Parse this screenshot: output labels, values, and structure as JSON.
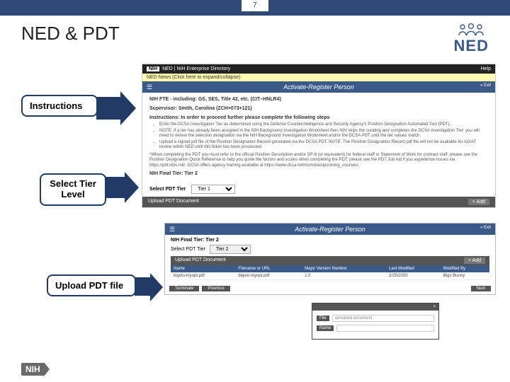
{
  "page_number": "7",
  "title": "NED & PDT",
  "logo_text": "NED",
  "callouts": {
    "c1": "Instructions",
    "c2": "Select Tier\nLevel",
    "c3": "Upload PDT file"
  },
  "ned_top": {
    "nih_tag": "NIH",
    "header": "NED | NIH Enterprise Directory",
    "help": "Help",
    "news": "NED News (Click here to expand/collapse)",
    "banner": "Activate-Register Person",
    "banner_end": "« Exit",
    "fte_line": "NIH FTE - including: GS, SES, Title 42, etc. (CIT–HNLR4)",
    "supervisor_line": "Supervisor: Smith, Carolina (ZCH+073+121)",
    "instr_header": "Instructions: In order to proceed further please complete the following steps",
    "bullets": [
      "Enter the DCSA Investigation Tier as determined using the Defense Counterintelligence and Security Agency's Position Designation Automated Tool (PDT).",
      "NOTE: If a tier has already been assigned in the NIH Background Investigation Worksheet then NIH skips the curating and completes the DCSA Investigation Tier; you will need to review the selection designation via the NIH Background Investigation Worksheet and/or the DCSA PDT until the tier values match.",
      "Upload a signed pdf file of the Position Designation Record generated via the DCSA PDT. NOTE: The Position Designation Record pdf file will not be available for AO/AT review within NED until this ticket has been processed."
    ],
    "footnote": "*When completing the PDT you must refer to the official Position Description and/or OF-8 (or equivalent) for federal staff or Statement of Work for contract staff; please see the Position Designation Quick Reference to help you guide the factors and scores when completing the PDT; please see the PDT Job Aid if you experience issues via https://pdt.nbis.mil/. DCSA offers agency training available at https://www.dcsa.mil/mc/ndse/upcoming_courses/.",
    "final_tier_label": "NIH Final Tier:",
    "final_tier_value": "Tier 2",
    "select_label": "Select PDT Tier",
    "tier_options": [
      "Tier 1"
    ],
    "upload_bar": "Upload PDT Document",
    "add": "+ Add"
  },
  "ned_second": {
    "banner": "Activate-Register Person",
    "banner_end": "« Exit",
    "tier_line_label": "NIH Final Tier:",
    "tier_line_value": "Tier 2",
    "select_label": "Select PDT Tier",
    "tier_options": [
      "Tier 2"
    ],
    "upload_label": "Upload PDT Document",
    "add": "+ Add",
    "table": {
      "headers": [
        "Name",
        "Filename or URL",
        "Major Version Number",
        "Last Modified",
        "Modified By"
      ],
      "row": [
        "bigvio-myopt.pdf",
        "bigvio-myopt.pdf",
        "1.0",
        "2/25/2020",
        "Bigs Bunny"
      ]
    },
    "buttons": {
      "terminate": "Terminate",
      "previous": "Previous",
      "next": "Next"
    }
  },
  "modal": {
    "header": "",
    "close": "×",
    "file_btn": "File",
    "file_value": "uploaded document",
    "name_btn": "Name",
    "name_value": ""
  },
  "footer_nih": "NIH"
}
